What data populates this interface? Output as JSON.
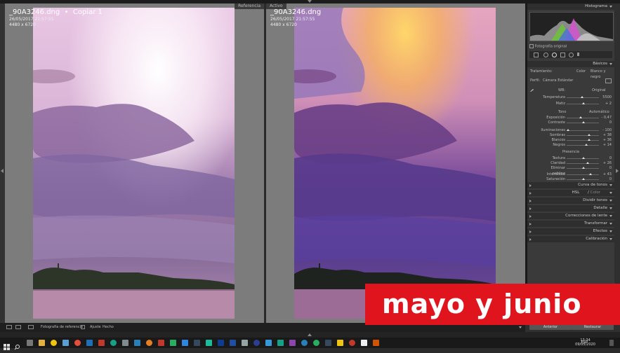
{
  "reference_pane": {
    "tag": "Referencia",
    "filename": "_90A3246.dng",
    "copy_label": "Copiar 1",
    "date": "26/05/2017 21:57:55",
    "dims": "4480 x 6720"
  },
  "active_pane": {
    "tag": "Activo",
    "filename": "_90A3246.dng",
    "date": "26/05/2017 21:57:55",
    "dims": "4480 x 6720"
  },
  "panel": {
    "histogram_title": "Histograma",
    "original_photo_label": "Fotografía original",
    "basicos_title": "Básicos",
    "tratamiento_label": "Tratamiento:",
    "color_label": "Color",
    "bw_label": "Blanco y negro",
    "perfil_label": "Perfil:",
    "perfil_value": "Cámara Estándar",
    "wb_label": "WB:",
    "wb_value": "Original",
    "temp": {
      "label": "Temperatura",
      "value": "5500"
    },
    "matiz": {
      "label": "Matiz",
      "value": "+ 2"
    },
    "tono_label": "Tono",
    "auto_label": "Automático",
    "exposicion": {
      "label": "Exposición",
      "value": "- 0,47"
    },
    "contraste": {
      "label": "Contraste",
      "value": "0"
    },
    "iluminaciones": {
      "label": "Iluminaciones",
      "value": "- 100"
    },
    "sombras": {
      "label": "Sombras",
      "value": "+ 38"
    },
    "blancos": {
      "label": "Blancos",
      "value": "+ 36"
    },
    "negros": {
      "label": "Negros",
      "value": "+ 14"
    },
    "presencia_label": "Presencia",
    "textura": {
      "label": "Textura",
      "value": "0"
    },
    "claridad": {
      "label": "Claridad",
      "value": "+ 26"
    },
    "neblina": {
      "label": "Eliminar neblina",
      "value": "0"
    },
    "intensidad": {
      "label": "Intensidad",
      "value": "+ 43"
    },
    "saturacion": {
      "label": "Saturación",
      "value": "0"
    },
    "sections": {
      "curva": "Curva de tonos",
      "hsl": "HSL",
      "hsl_color": "Color",
      "dividir": "Dividir tonos",
      "detalle": "Detalle",
      "lente": "Correcciones de lente",
      "transformar": "Transformar",
      "efectos": "Efectos",
      "calibracion": "Calibración"
    },
    "prev_button": "Anterior",
    "reset_button": "Restaurar"
  },
  "filmstrip": {
    "reference_label": "Fotografía de referencia",
    "ajuste_label": "Ajuste",
    "done_label": "Hecho"
  },
  "taskbar": {
    "lang": "ESP",
    "time": "13:34",
    "date": "09/05/2020"
  },
  "banner": {
    "text": "mayo y junio",
    "color": "#e0141c"
  }
}
